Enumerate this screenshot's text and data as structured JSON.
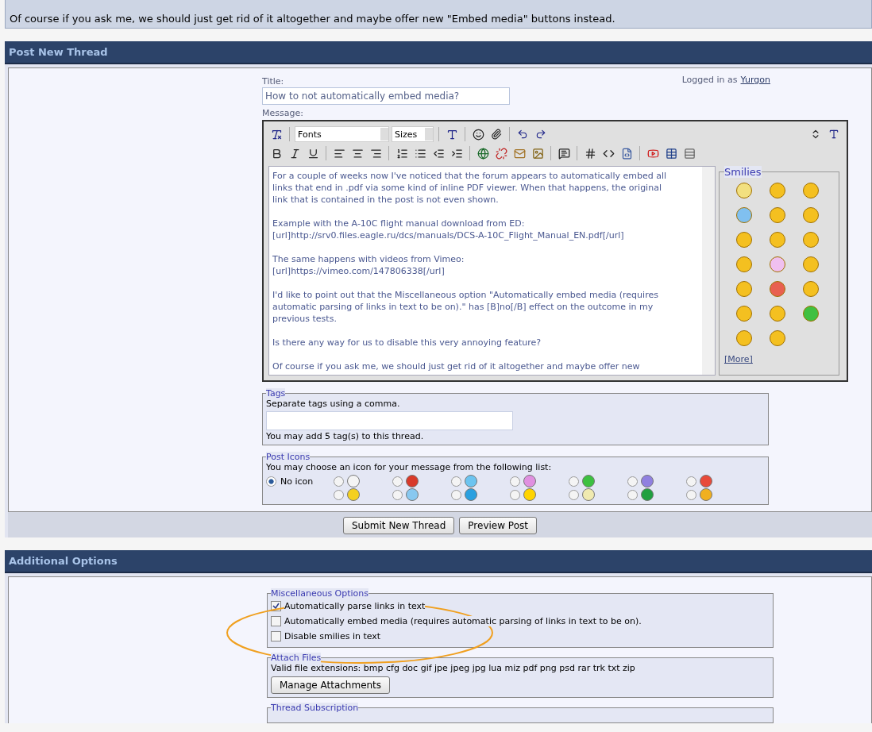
{
  "previous_post": {
    "text": "Of course if you ask me, we should just get rid of it altogether and maybe offer new \"Embed media\" buttons instead."
  },
  "post_new_thread": {
    "title": "Post New Thread",
    "title_label": "Title:",
    "title_value": "How to not automatically embed media?",
    "logged_in_text": "Logged in as",
    "username": "Yurgon",
    "message_label": "Message:",
    "editor": {
      "font_select": "Fonts",
      "size_select": "Sizes",
      "paragraphs": [
        "For a couple of weeks now I've noticed that the forum appears to automatically embed all\nlinks that end in .pdf via some kind of inline PDF viewer. When that happens, the original\nlink that is contained in the post is not even shown.",
        "Example with the A-10C flight manual download from ED:\n[url]http://srv0.files.eagle.ru/dcs/manuals/DCS-A-10C_Flight_Manual_EN.pdf[/url]",
        "The same happens with videos from Vimeo:\n[url]https://vimeo.com/147806338[/url]",
        "I'd like to point out that the Miscellaneous option \"Automatically embed media (requires\nautomatic parsing of links in text to be on).\" has [B]no[/B] effect on the outcome in my\nprevious tests.",
        "Is there any way for us to disable this very annoying feature?",
        "Of course if you ask me, we should just get rid of it altogether and maybe offer new"
      ],
      "smilies_title": "Smilies",
      "more_link": "[More]"
    },
    "tags": {
      "legend": "Tags",
      "hint": "Separate tags using a comma.",
      "note": "You may add 5 tag(s) to this thread."
    },
    "post_icons": {
      "legend": "Post Icons",
      "hint": "You may choose an icon for your message from the following list:",
      "no_icon": {
        "label": "No icon",
        "selected": true
      },
      "options": [
        {
          "selected": false,
          "color": "#f4f4f4"
        },
        {
          "selected": false,
          "color": "#d83a2a"
        },
        {
          "selected": false,
          "color": "#6cc4f0"
        },
        {
          "selected": false,
          "color": "#e090e0"
        },
        {
          "selected": false,
          "color": "#3cc040"
        },
        {
          "selected": false,
          "color": "#9080e0"
        },
        {
          "selected": false,
          "color": "#e84a3a"
        },
        {
          "selected": false,
          "color": "#f4d020"
        },
        {
          "selected": false,
          "color": "#88c8f0"
        },
        {
          "selected": false,
          "color": "#2aa0e0"
        },
        {
          "selected": false,
          "color": "#ffd400"
        },
        {
          "selected": false,
          "color": "#f0eab0"
        },
        {
          "selected": false,
          "color": "#20a040"
        },
        {
          "selected": false,
          "color": "#f0b020"
        }
      ]
    },
    "buttons": [
      "Submit New Thread",
      "Preview Post"
    ]
  },
  "additional_options": {
    "title": "Additional Options",
    "misc": {
      "legend": "Miscellaneous Options",
      "options": [
        {
          "label": "Automatically parse links in text",
          "checked": true
        },
        {
          "label": "Automatically embed media (requires automatic parsing of links in text to be on).",
          "checked": false
        },
        {
          "label": "Disable smilies in text",
          "checked": false
        }
      ]
    },
    "attach": {
      "legend": "Attach Files",
      "extensions": "Valid file extensions: bmp cfg doc gif jpe jpeg jpg lua miz pdf png psd rar trk txt zip",
      "button": "Manage Attachments"
    },
    "subscription": {
      "legend": "Thread Subscription"
    }
  }
}
